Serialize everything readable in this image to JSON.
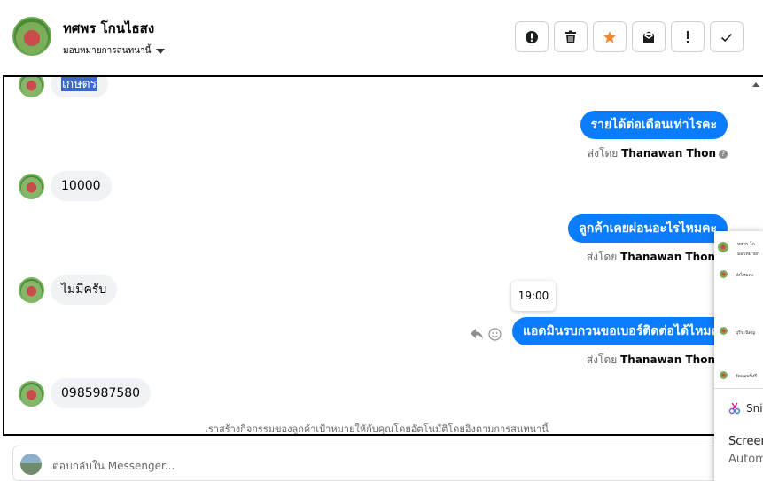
{
  "header": {
    "contact_name": "ทศพร โกนไธสง",
    "assign_label": "มอบหมายการสนทนานี้"
  },
  "toolbar": {
    "buttons": [
      "alert-circle-icon",
      "trash-icon",
      "star-icon",
      "mark-unread-icon",
      "exclamation-icon",
      "check-icon"
    ],
    "star_color": "#f5852a"
  },
  "messages": {
    "m1_in": "เกษตร",
    "m2_out": "รายได้ต่อเดือนเท่าไรคะ",
    "m2_sent_prefix": "ส่งโดย",
    "m2_sender": "Thanawan Thon",
    "m3_in": "10000",
    "m4_out": "ลูกค้าเคยผ่อนอะไรไหมคะ",
    "m4_sent_prefix": "ส่งโดย",
    "m4_sender": "Thanawan Thon",
    "m5_in": "ไม่มีครับ",
    "m6_out": "แอดมินรบกวนขอเบอร์ติดต่อได้ไหมคะ",
    "m6_sent_prefix": "ส่งโดย",
    "m6_sender": "Thanawan Thon",
    "m7_in": "0985987580",
    "tooltip_time": "19:00",
    "help_glyph": "?"
  },
  "footnote": "เราสร้างกิจกรรมของลูกค้าเป้าหมายให้กับคุณโดยอัตโนมัติโดยอิงตามการสนทนานี้",
  "reply": {
    "placeholder": "ตอบกลับใน Messenger..."
  },
  "popup": {
    "mini_name": "ทศพร โก",
    "mini_sub": "มอบหมายก",
    "mini_m1": "ส่งไหมคะ",
    "mini_m2": "บุริระนิดญ",
    "mini_m3": "รัดแบบซิ่งรี",
    "snip_label": "Sni",
    "line1": "Screen",
    "line2": "Autom"
  },
  "colors": {
    "accent_blue": "#0a7cff",
    "incoming_bg": "#f0f2f5",
    "selection": "#3a69c6"
  }
}
